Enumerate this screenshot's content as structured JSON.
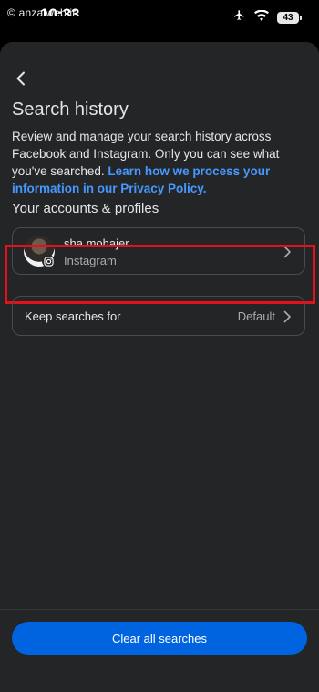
{
  "status_bar": {
    "watermark": "© anzalweb.ir",
    "time": "10:33",
    "battery": "43",
    "icons": [
      "airplane-icon",
      "wifi-icon",
      "battery-icon"
    ]
  },
  "page": {
    "title": "Search history",
    "description": "Review and manage your search history across Facebook and Instagram. Only you can see what you've searched. ",
    "privacy_link": "Learn how we process your information in our Privacy Policy."
  },
  "accounts": {
    "section_title": "Your accounts & profiles",
    "items": [
      {
        "name": "sha.mohajer",
        "platform": "Instagram"
      }
    ]
  },
  "keep_searches": {
    "label": "Keep searches for",
    "value": "Default"
  },
  "clear_button": {
    "label": "Clear all searches"
  },
  "colors": {
    "background": "#242527",
    "link": "#4599ff",
    "primary_button": "#0064e0",
    "highlight": "#e3121a"
  }
}
